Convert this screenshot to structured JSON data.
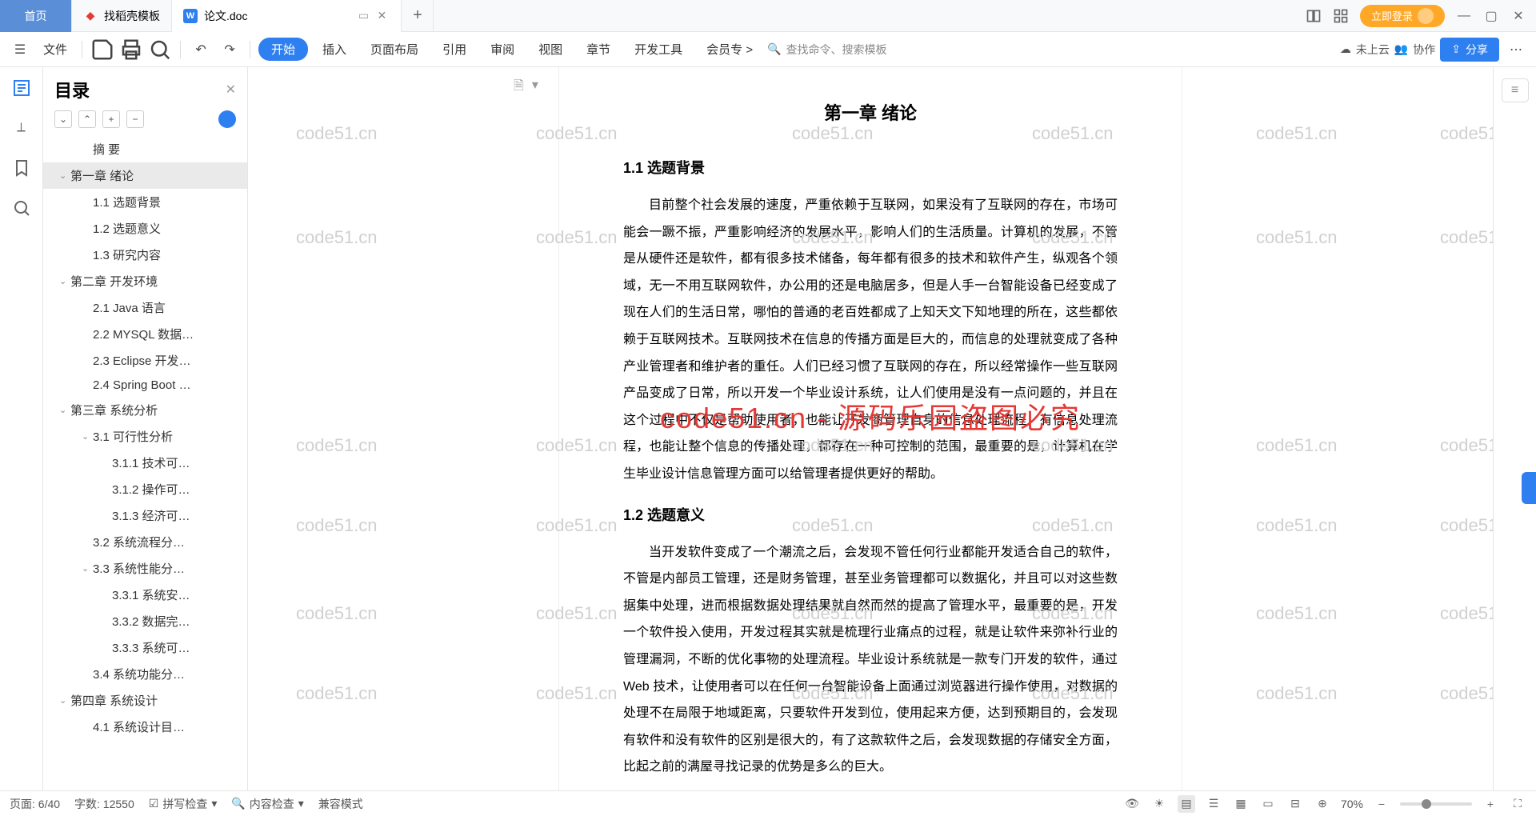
{
  "tabs": {
    "home": "首页",
    "t1": "找稻壳模板",
    "t2": "论文.doc"
  },
  "login": "立即登录",
  "toolbar": {
    "file": "文件",
    "menus": [
      "开始",
      "插入",
      "页面布局",
      "引用",
      "审阅",
      "视图",
      "章节",
      "开发工具",
      "会员专"
    ],
    "search": "查找命令、搜索模板",
    "cloud": "未上云",
    "collab": "协作",
    "share": "分享"
  },
  "outline": {
    "title": "目录",
    "items": [
      {
        "lvl": 2,
        "txt": "摘 要"
      },
      {
        "lvl": 1,
        "txt": "第一章 绪论",
        "chev": "v",
        "active": true
      },
      {
        "lvl": 2,
        "txt": "1.1 选题背景"
      },
      {
        "lvl": 2,
        "txt": "1.2 选题意义"
      },
      {
        "lvl": 2,
        "txt": "1.3 研究内容"
      },
      {
        "lvl": 1,
        "txt": "第二章 开发环境",
        "chev": "v"
      },
      {
        "lvl": 2,
        "txt": "2.1 Java 语言"
      },
      {
        "lvl": 2,
        "txt": "2.2 MYSQL 数据…"
      },
      {
        "lvl": 2,
        "txt": "2.3 Eclipse 开发…"
      },
      {
        "lvl": 2,
        "txt": "2.4 Spring Boot …"
      },
      {
        "lvl": 1,
        "txt": "第三章 系统分析",
        "chev": "v"
      },
      {
        "lvl": 2,
        "txt": "3.1 可行性分析",
        "chev": "v"
      },
      {
        "lvl": 3,
        "txt": "3.1.1 技术可…"
      },
      {
        "lvl": 3,
        "txt": "3.1.2 操作可…"
      },
      {
        "lvl": 3,
        "txt": "3.1.3 经济可…"
      },
      {
        "lvl": 2,
        "txt": "3.2 系统流程分…"
      },
      {
        "lvl": 2,
        "txt": "3.3 系统性能分…",
        "chev": "v"
      },
      {
        "lvl": 3,
        "txt": "3.3.1 系统安…"
      },
      {
        "lvl": 3,
        "txt": "3.3.2 数据完…"
      },
      {
        "lvl": 3,
        "txt": "3.3.3 系统可…"
      },
      {
        "lvl": 2,
        "txt": "3.4 系统功能分…"
      },
      {
        "lvl": 1,
        "txt": "第四章 系统设计",
        "chev": "v"
      },
      {
        "lvl": 2,
        "txt": "4.1 系统设计目…"
      }
    ]
  },
  "doc": {
    "chapter": "第一章 绪论",
    "s11": "1.1 选题背景",
    "p1": "目前整个社会发展的速度，严重依赖于互联网，如果没有了互联网的存在，市场可能会一蹶不振，严重影响经济的发展水平，影响人们的生活质量。计算机的发展，不管是从硬件还是软件，都有很多技术储备，每年都有很多的技术和软件产生，纵观各个领域，无一不用互联网软件，办公用的还是电脑居多，但是人手一台智能设备已经变成了现在人们的生活日常，哪怕的普通的老百姓都成了上知天文下知地理的所在，这些都依赖于互联网技术。互联网技术在信息的传播方面是巨大的，而信息的处理就变成了各种产业管理者和维护者的重任。人们已经习惯了互联网的存在，所以经常操作一些互联网产品变成了日常，所以开发一个毕业设计系统，让人们使用是没有一点问题的，并且在这个过程中不仅是帮助使用者，也能让开发商管理自身的信息处理流程，有信息处理流程，也能让整个信息的传播处理，都存在一种可控制的范围，最重要的是，计算机在学生毕业设计信息管理方面可以给管理者提供更好的帮助。",
    "s12": "1.2 选题意义",
    "p2": "当开发软件变成了一个潮流之后，会发现不管任何行业都能开发适合自己的软件，不管是内部员工管理，还是财务管理，甚至业务管理都可以数据化，并且可以对这些数据集中处理，进而根据数据处理结果就自然而然的提高了管理水平，最重要的是，开发一个软件投入使用，开发过程其实就是梳理行业痛点的过程，就是让软件来弥补行业的管理漏洞，不断的优化事物的处理流程。毕业设计系统就是一款专门开发的软件，通过 Web 技术，让使用者可以在任何一台智能设备上面通过浏览器进行操作使用，对数据的处理不在局限于地域距离，只要软件开发到位，使用起来方便，达到预期目的，会发现有软件和没有软件的区别是很大的，有了这款软件之后，会发现数据的存储安全方面，比起之前的满屋寻找记录的优势是多么的巨大。"
  },
  "watermark": {
    "red": "code51.cn - 源码乐园盗图必究",
    "grey": "code51.cn"
  },
  "status": {
    "page": "页面: 6/40",
    "words": "字数: 12550",
    "spell": "拼写检查",
    "content": "内容检查",
    "compat": "兼容模式",
    "zoom": "70%"
  }
}
